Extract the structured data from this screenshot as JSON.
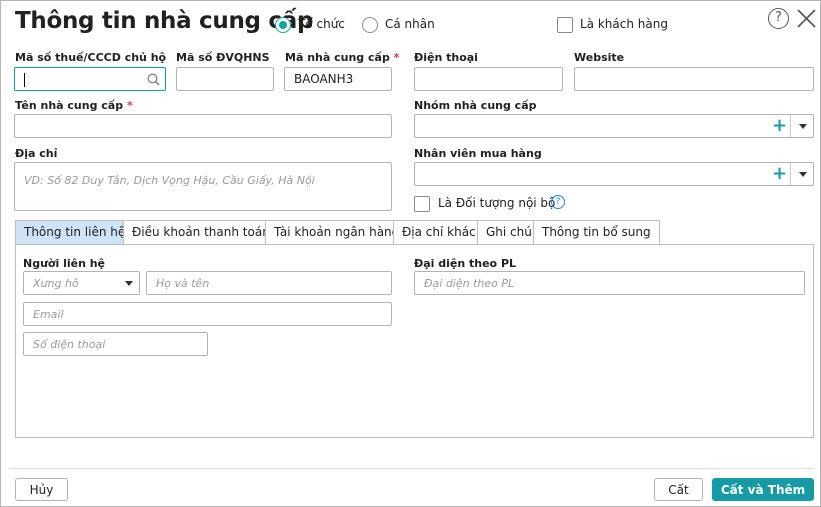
{
  "header": {
    "title": "Thông tin nhà cung cấp",
    "type_options": [
      {
        "label": "Tổ chức",
        "selected": true
      },
      {
        "label": "Cá nhân",
        "selected": false
      }
    ],
    "is_customer_label": "Là khách hàng"
  },
  "fields": {
    "tax_code_label": "Mã số thuế/CCCD chủ hộ",
    "tax_code_value": "",
    "budget_code_label": "Mã số ĐVQHNS",
    "supplier_code_label": "Mã nhà cung cấp",
    "supplier_code_value": "BAOANH3",
    "phone_label": "Điện thoại",
    "website_label": "Website",
    "supplier_name_label": "Tên nhà cung cấp",
    "group_label": "Nhóm nhà cung cấp",
    "address_label": "Địa chỉ",
    "address_placeholder": "VD: Số 82 Duy Tân, Dịch Vọng Hậu, Cầu Giấy, Hà Nội",
    "buyer_label": "Nhân viên mua hàng",
    "internal_label": "Là Đối tượng nội bộ",
    "required_mark": "*"
  },
  "tabs": [
    {
      "label": "Thông tin liên hệ",
      "active": true
    },
    {
      "label": "Điều khoản thanh toán"
    },
    {
      "label": "Tài khoản ngân hàng"
    },
    {
      "label": "Địa chỉ khác"
    },
    {
      "label": "Ghi chú"
    },
    {
      "label": "Thông tin bổ sung"
    }
  ],
  "contact": {
    "contact_label": "Người liên hệ",
    "salutation_placeholder": "Xưng hô",
    "fullname_placeholder": "Họ và tên",
    "email_placeholder": "Email",
    "phone_placeholder": "Số điện thoại",
    "legal_rep_label": "Đại diện theo PL",
    "legal_rep_placeholder": "Đại diện theo PL"
  },
  "footer": {
    "cancel": "Hủy",
    "save": "Cất",
    "save_add": "Cất và Thêm"
  },
  "colors": {
    "accent": "#14a0a9",
    "active_tab": "#cfe3f7",
    "required": "#e53935"
  }
}
